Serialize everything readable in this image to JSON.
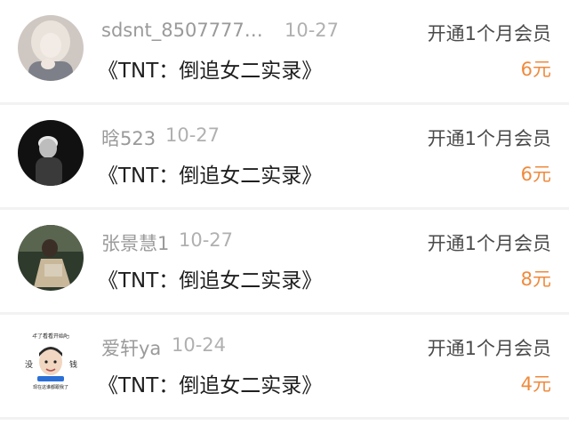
{
  "records": [
    {
      "user": "sdsnt_85077774...",
      "date": "10-27",
      "title": "《TNT：倒追女二实录》",
      "action": "开通1个月会员",
      "price": "6元",
      "avatar": "blonde-person-avatar"
    },
    {
      "user": "晗523",
      "date": "10-27",
      "title": "《TNT：倒追女二实录》",
      "action": "开通1个月会员",
      "price": "6元",
      "avatar": "dark-portrait-avatar"
    },
    {
      "user": "张景慧1",
      "date": "10-27",
      "title": "《TNT：倒追女二实录》",
      "action": "开通1个月会员",
      "price": "8元",
      "avatar": "seated-person-avatar"
    },
    {
      "user": "爱轩ya",
      "date": "10-24",
      "title": "《TNT：倒追女二实录》",
      "action": "开通1个月会员",
      "price": "4元",
      "avatar": "meme-face-avatar",
      "avatar_text": {
        "top": "年了看看开始吧",
        "left": "没",
        "right": "钱",
        "bottom": "现在这谁都跟我了"
      }
    }
  ],
  "colors": {
    "price": "#ef8a3c",
    "muted": "#9a9a9a",
    "title": "#1f1f1f"
  }
}
